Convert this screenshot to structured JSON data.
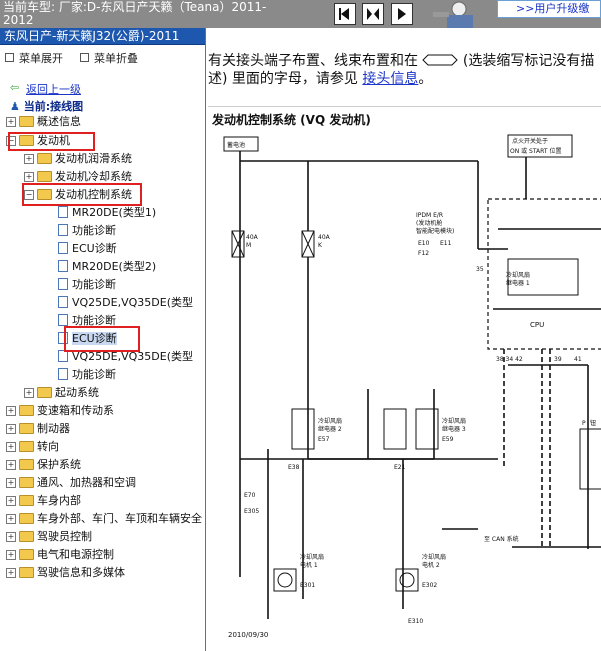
{
  "header": {
    "vehicle": "当前车型:  厂家:D-东风日产天籁（Teana）2011-2012",
    "upgrade_link": ">>用户升级缴"
  },
  "sidebar": {
    "model_title": "东风日产-新天籁J32(公爵)-2011",
    "expand_label": "菜单展开",
    "collapse_label": "菜单折叠",
    "back_link": "返回上一级",
    "current_label": "当前:接线图",
    "tree": [
      {
        "label": "概述信息"
      },
      {
        "label": "发动机"
      },
      {
        "label": "发动机润滑系统"
      },
      {
        "label": "发动机冷却系统"
      },
      {
        "label": "发动机控制系统"
      },
      {
        "label": "MR20DE(类型1)"
      },
      {
        "label": "功能诊断"
      },
      {
        "label": "ECU诊断"
      },
      {
        "label": "MR20DE(类型2)"
      },
      {
        "label": "功能诊断"
      },
      {
        "label": "VQ25DE,VQ35DE(类型"
      },
      {
        "label": "功能诊断"
      },
      {
        "label": "ECU诊断"
      },
      {
        "label": "VQ25DE,VQ35DE(类型"
      },
      {
        "label": "功能诊断"
      },
      {
        "label": "起动系统"
      },
      {
        "label": "变速箱和传动系"
      },
      {
        "label": "制动器"
      },
      {
        "label": "转向"
      },
      {
        "label": "保护系统"
      },
      {
        "label": "通风、加热器和空调"
      },
      {
        "label": "车身内部"
      },
      {
        "label": "车身外部、车门、车顶和车辆安全"
      },
      {
        "label": "驾驶员控制"
      },
      {
        "label": "电气和电源控制"
      },
      {
        "label": "驾驶信息和多媒体"
      }
    ]
  },
  "main": {
    "intro_part1": "有关接头端子布置、线束布置和在",
    "intro_part2": "(选装缩写标记没有描述) 里面的字母，请参见",
    "intro_link": "接头信息",
    "intro_end": "。"
  },
  "diagram": {
    "title": "发动机控制系统 (VQ 发动机)",
    "battery": "蓄电池",
    "ignition": "点火开关处于",
    "ignition2": "ON 或 START 位置",
    "ipdm": "IPDM E/R",
    "ipdm2": "(发动机舱",
    "ipdm3": "智能配电模块)",
    "conn_e10": "E10",
    "conn_e11": "E11",
    "conn_f12": "F12",
    "fuse1": "40A",
    "fuse1_id": "M",
    "fuse2": "40A",
    "fuse2_id": "K",
    "relay1": "冷却风扇",
    "relay1b": "继电器 1",
    "relay2": "冷却风扇",
    "relay2b": "继电器 2",
    "relay3": "冷却风扇",
    "relay3b": "继电器 3",
    "cpu": "CPU",
    "pins": "38  34  42",
    "pin39": "39",
    "pin41": "41",
    "pin35": "35",
    "e57": "E57",
    "e59": "E59",
    "e38": "E38",
    "e21": "E21",
    "e70": "E70",
    "e305": "E305",
    "motor1": "冷却风扇",
    "motor1b": "电机 1",
    "e301": "E301",
    "motor2": "冷却风扇",
    "motor2b": "电机 2",
    "e302": "E302",
    "e310": "E310",
    "can": "至 CAN 系统",
    "date": "2010/09/30",
    "p_label": "P",
    "p_sub": "钮"
  },
  "colors": {
    "topbar": "#8a8a8a",
    "model_bar": "#1d57ae",
    "highlight": "#e02020",
    "link": "#1a35c8"
  }
}
